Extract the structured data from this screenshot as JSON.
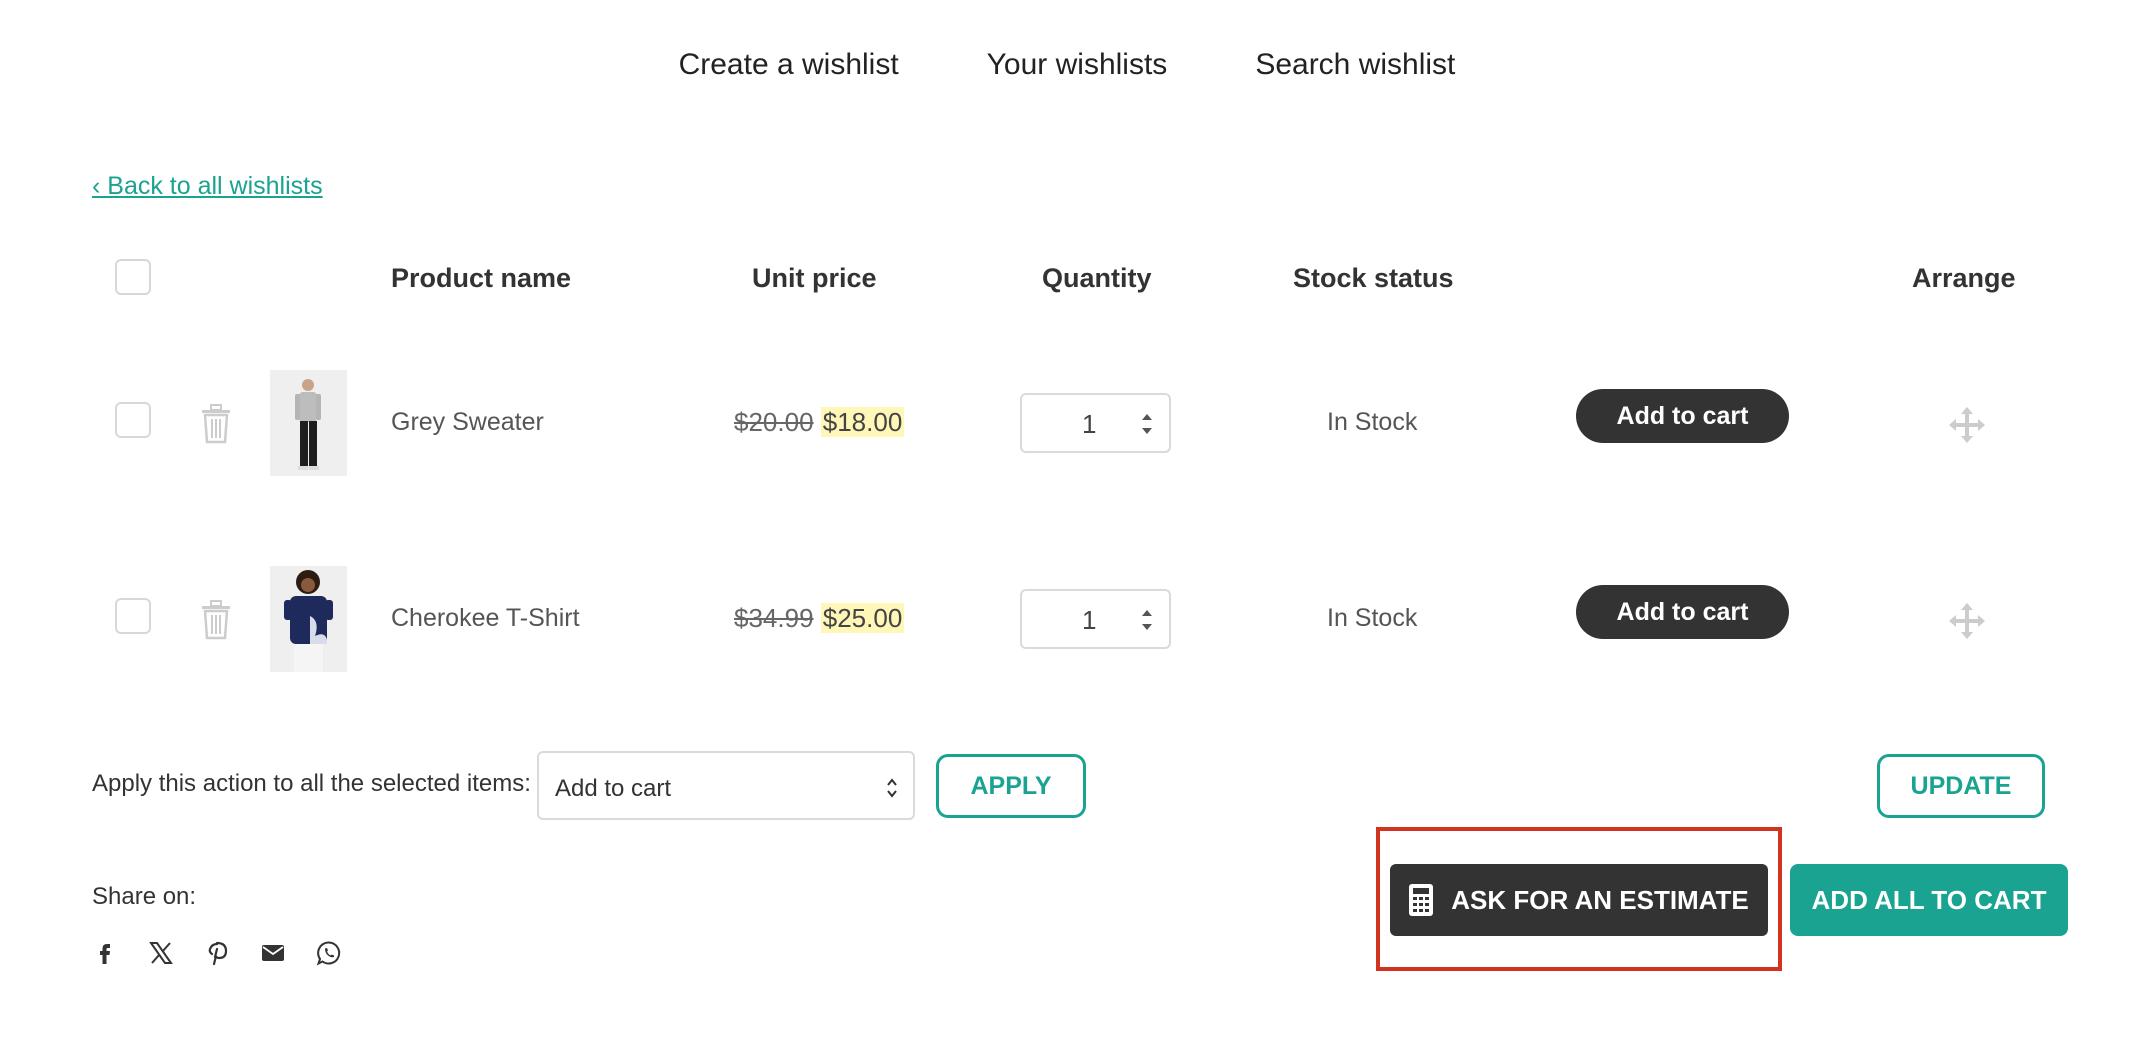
{
  "nav": {
    "items": [
      "Create a wishlist",
      "Your wishlists",
      "Search wishlist"
    ]
  },
  "back_link": "‹ Back to all wishlists",
  "table": {
    "headers": {
      "product": "Product name",
      "price": "Unit price",
      "quantity": "Quantity",
      "stock": "Stock status",
      "arrange": "Arrange"
    },
    "rows": [
      {
        "name": "Grey Sweater",
        "old_price": "$20.00",
        "new_price": "$18.00",
        "quantity": "1",
        "stock": "In Stock",
        "button": "Add to cart"
      },
      {
        "name": "Cherokee T-Shirt",
        "old_price": "$34.99",
        "new_price": "$25.00",
        "quantity": "1",
        "stock": "In Stock",
        "button": "Add to cart"
      }
    ]
  },
  "bulk": {
    "label": "Apply this action to all the selected items:",
    "selected": "Add to cart",
    "apply": "APPLY",
    "update": "UPDATE"
  },
  "share": {
    "label": "Share on:",
    "icons": [
      "facebook-icon",
      "x-icon",
      "pinterest-icon",
      "email-icon",
      "whatsapp-icon"
    ]
  },
  "actions": {
    "estimate": "ASK FOR AN ESTIMATE",
    "add_all": "ADD ALL TO CART"
  },
  "colors": {
    "accent": "#1aa390",
    "dark_button": "#333333",
    "highlight_border": "#d1331f",
    "sale_price_bg": "#fff7b8"
  }
}
